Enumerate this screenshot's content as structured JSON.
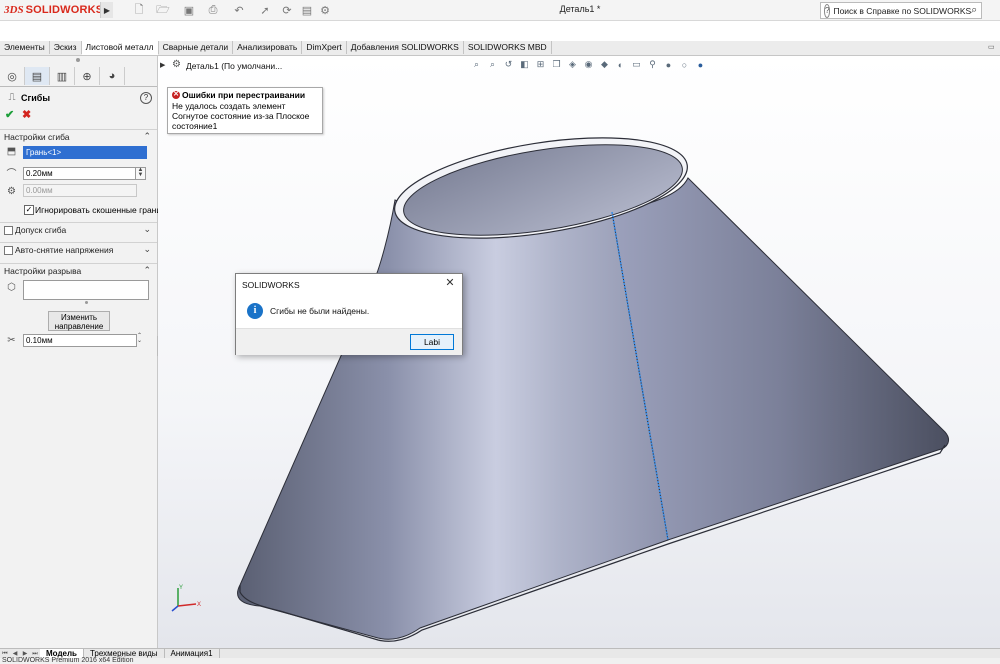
{
  "app": {
    "logo_prefix": "3DS",
    "logo_name": "SOLIDWORKS",
    "document_title": "Деталь1 *",
    "help_search_placeholder": "Поиск в Справке по SOLIDWORKS"
  },
  "command_tabs": [
    "Элементы",
    "Эскиз",
    "Листовой металл",
    "Сварные детали",
    "Анализировать",
    "DimXpert",
    "Добавления SOLIDWORKS",
    "SOLIDWORKS MBD"
  ],
  "active_command_tab": "Листовой металл",
  "property_manager": {
    "title": "Сгибы",
    "sections": {
      "bend_settings": {
        "label": "Настройки сгиба",
        "face_value": "Грань<1>",
        "radius_value": "0.20мм",
        "thickness_value": "0.00мм",
        "ignore_bevel_label": "Игнорировать скошенные грани",
        "ignore_bevel_checked": true
      },
      "bend_allowance": {
        "label": "Допуск сгиба"
      },
      "auto_relief": {
        "label": "Авто-снятие напряжения"
      },
      "rip_settings": {
        "label": "Настройки разрыва",
        "edges_value": "",
        "change_direction_label": "Изменить направление",
        "gap_value": "0.10мм"
      }
    }
  },
  "feature_tree": {
    "label": "Деталь1 (По умолчани..."
  },
  "rebuild_error": {
    "title": "Ошибки при перестраивании",
    "message": "Не удалось создать элемент Согнутое состояние из-за Плоское состояние1"
  },
  "dialog": {
    "title": "SOLIDWORKS",
    "message": "Сгибы не были найдены.",
    "button_label": "Labi"
  },
  "bottom_tabs": [
    "Модель",
    "Трехмерные виды",
    "Анимация1"
  ],
  "active_bottom_tab": "Модель",
  "status": {
    "text": "SOLIDWORKS Premium 2016 x64 Edition"
  },
  "colors": {
    "brand_red": "#d9291c",
    "selection_blue": "#2f6fd1",
    "ok_green": "#1d9f3a",
    "cancel_red": "#d3251f",
    "info_blue": "#1a73c8",
    "part_metal": "#9a9fb7"
  }
}
